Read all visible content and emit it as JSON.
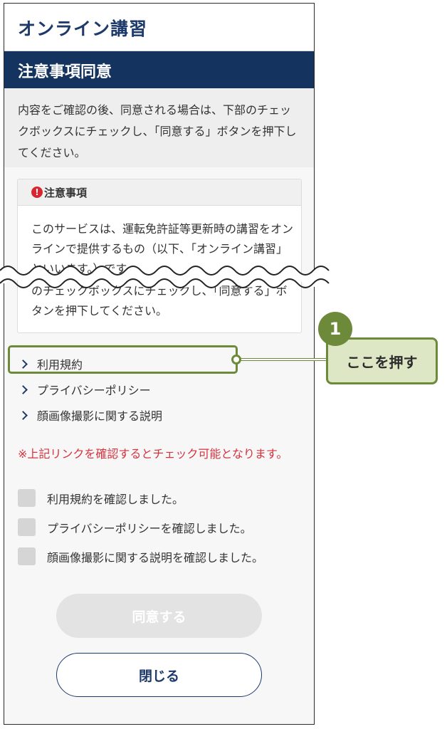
{
  "app": {
    "title": "オンライン講習"
  },
  "section": {
    "title": "注意事項同意"
  },
  "intro_text": "内容をご確認の後、同意される場合は、下部のチェックボックスにチェックし、「同意する」ボタンを押下してください。",
  "notice": {
    "heading": "注意事項",
    "icon": "!",
    "text_top": "このサービスは、運転免許証等更新時の講習をオンラインで提供するもの（以下、「オンライン講習」といいます。）です。",
    "text_bottom": "のチェックボックスにチェックし、「同意する」ボタンを押下してください。"
  },
  "links": [
    {
      "label": "利用規約"
    },
    {
      "label": "プライバシーポリシー"
    },
    {
      "label": "顔画像撮影に関する説明"
    }
  ],
  "warning": "※上記リンクを確認するとチェック可能となります。",
  "checkboxes": [
    {
      "label": "利用規約を確認しました。"
    },
    {
      "label": "プライバシーポリシーを確認しました。"
    },
    {
      "label": "顔画像撮影に関する説明を確認しました。"
    }
  ],
  "buttons": {
    "agree": "同意する",
    "close": "閉じる"
  },
  "annotation": {
    "step": "1",
    "text": "ここを押す"
  },
  "colors": {
    "navy": "#14335e",
    "accent_green": "#6d8a3a",
    "callout_fill": "#dde7c5",
    "warning_red": "#d6333f"
  }
}
